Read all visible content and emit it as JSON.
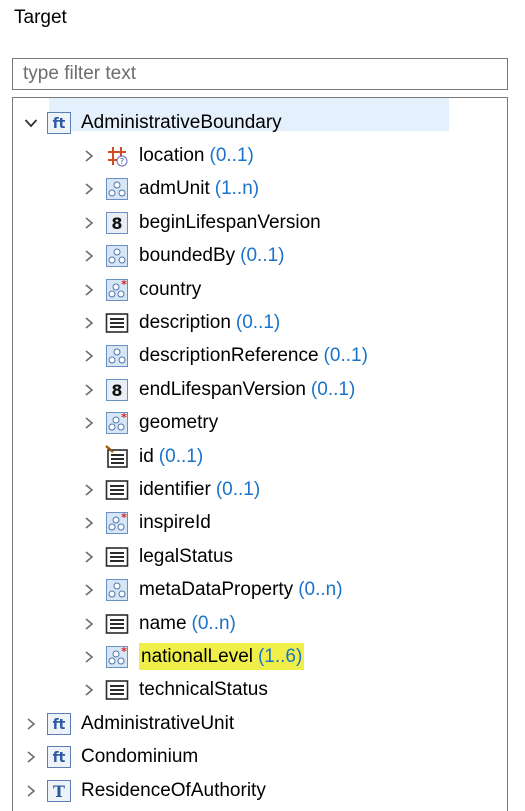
{
  "panel": {
    "title": "Target"
  },
  "filter": {
    "placeholder": "type filter text"
  },
  "tree": {
    "root": {
      "label": "AdministrativeBoundary",
      "icon": "feature-type-icon"
    },
    "children": [
      {
        "label": "location",
        "card": "(0..1)",
        "icon": "geometry-property-icon"
      },
      {
        "label": "admUnit",
        "card": "(1..n)",
        "icon": "complex-property-icon"
      },
      {
        "label": "beginLifespanVersion",
        "card": "",
        "icon": "number-property-icon"
      },
      {
        "label": "boundedBy",
        "card": "(0..1)",
        "icon": "complex-property-icon"
      },
      {
        "label": "country",
        "card": "",
        "icon": "required-complex-property-icon"
      },
      {
        "label": "description",
        "card": "(0..1)",
        "icon": "text-property-icon"
      },
      {
        "label": "descriptionReference",
        "card": "(0..1)",
        "icon": "complex-property-icon"
      },
      {
        "label": "endLifespanVersion",
        "card": "(0..1)",
        "icon": "number-property-icon"
      },
      {
        "label": "geometry",
        "card": "",
        "icon": "required-complex-property-icon"
      },
      {
        "label": "id",
        "card": "(0..1)",
        "icon": "attribute-property-icon"
      },
      {
        "label": "identifier",
        "card": "(0..1)",
        "icon": "text-property-icon"
      },
      {
        "label": "inspireId",
        "card": "",
        "icon": "required-complex-property-icon"
      },
      {
        "label": "legalStatus",
        "card": "",
        "icon": "text-property-icon"
      },
      {
        "label": "metaDataProperty",
        "card": "(0..n)",
        "icon": "complex-property-icon"
      },
      {
        "label": "name",
        "card": "(0..n)",
        "icon": "text-property-icon"
      },
      {
        "label": "nationalLevel",
        "card": "(1..6)",
        "icon": "required-complex-property-icon"
      },
      {
        "label": "technicalStatus",
        "card": "",
        "icon": "text-property-icon"
      }
    ],
    "siblings": [
      {
        "label": "AdministrativeUnit",
        "icon": "feature-type-icon"
      },
      {
        "label": "Condominium",
        "icon": "feature-type-icon"
      },
      {
        "label": "ResidenceOfAuthority",
        "icon": "type-icon"
      }
    ]
  }
}
